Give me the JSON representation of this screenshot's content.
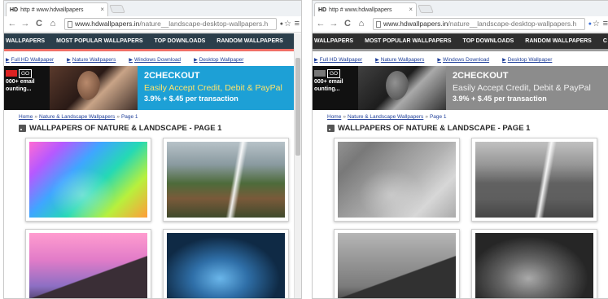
{
  "tab": {
    "icon_text": "HD",
    "title": "http # www.hdwallpapers",
    "close": "×"
  },
  "toolbar": {
    "back": "←",
    "forward": "→",
    "reload": "C",
    "home": "⌂",
    "url_host": "www.hdwallpapers.in",
    "url_path": "/nature__landscape-desktop-wallpapers.h",
    "bookmark_icon": "☆",
    "menu_icon": "≡",
    "extension_icon": "●"
  },
  "navbar": {
    "items": [
      "WALLPAPERS",
      "MOST POPULAR WALLPAPERS",
      "TOP DOWNLOADS",
      "RANDOM WALLPAPERS",
      "C"
    ]
  },
  "subnav": {
    "items": [
      "Full HD Wallpaper",
      "Nature Wallpapers",
      "Windows Download",
      "Desktop Wallpaper"
    ]
  },
  "banner": {
    "go": "GO",
    "left_line1": "000+ email",
    "left_line2": "ounting...",
    "title": "2CHECKOUT",
    "tagline": "Easily Accept Credit, Debit & PayPal",
    "price": "3.9% + $.45 per transaction"
  },
  "breadcrumb": {
    "home": "Home",
    "sep1": "»",
    "section": "Nature & Landscape Wallpapers",
    "sep2": "»",
    "page": "Page 1"
  },
  "heading": "WALLPAPERS OF NATURE & LANDSCAPE - PAGE 1",
  "colors": {
    "navbar_bg": "#2b3e4b",
    "navbar_accent": "#f06f66",
    "banner_bg": "#1da0d6",
    "banner_tagline": "#ffe36b",
    "link": "#1f3f99"
  }
}
